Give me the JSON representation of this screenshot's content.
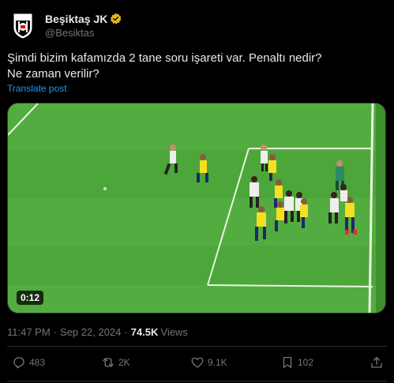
{
  "author": {
    "display_name": "Beşiktaş JK",
    "handle": "@Besiktas",
    "verified_badge_color": "#e2b719"
  },
  "tweet": {
    "text_line1": "Şimdi bizim kafamızda 2 tane soru işareti var. Penaltı nedir?",
    "text_line2": "Ne zaman verilir?",
    "translate_label": "Translate post"
  },
  "media": {
    "type": "video",
    "duration": "0:12",
    "pitch_color": "#4da63a"
  },
  "meta": {
    "time": "11:47 PM",
    "separator": "·",
    "date": "Sep 22, 2024",
    "views_count": "74.5K",
    "views_label": "Views"
  },
  "actions": {
    "replies": "483",
    "reposts": "2K",
    "likes": "9.1K",
    "bookmarks": "102"
  },
  "colors": {
    "background": "#000000",
    "text": "#e7e9ea",
    "muted": "#71767b",
    "link": "#1d9bf0",
    "border": "#2f3336"
  }
}
